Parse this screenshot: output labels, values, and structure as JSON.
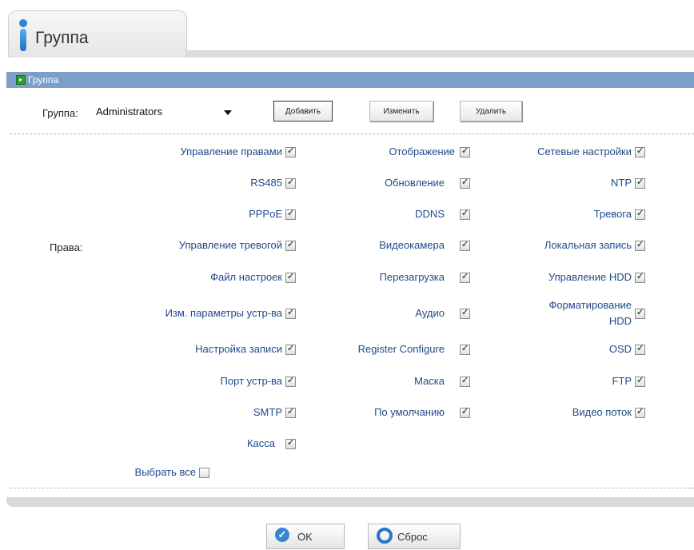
{
  "tab": {
    "title": "Группа"
  },
  "section": {
    "title": "Группа"
  },
  "group": {
    "label": "Группа:",
    "selected": "Administrators",
    "add_label": "Добавить",
    "edit_label": "Изменить",
    "delete_label": "Удалить"
  },
  "rights_label": "Права:",
  "permissions": {
    "col1": [
      {
        "label": "Управление правами",
        "checked": true
      },
      {
        "label": "RS485",
        "checked": true
      },
      {
        "label": "PPPoE",
        "checked": true
      },
      {
        "label": "Управление тревогой",
        "checked": true
      },
      {
        "label": "Файл настроек",
        "checked": true
      },
      {
        "label": "Изм. параметры устр-ва",
        "checked": true
      },
      {
        "label": "Настройка записи",
        "checked": true
      },
      {
        "label": "Порт устр-ва",
        "checked": true
      },
      {
        "label": "SMTP",
        "checked": true
      },
      {
        "label": "Касса",
        "checked": true
      }
    ],
    "col2": [
      {
        "label": "Отображение",
        "checked": true
      },
      {
        "label": "Обновление",
        "checked": true
      },
      {
        "label": "DDNS",
        "checked": true
      },
      {
        "label": "Видеокамера",
        "checked": true
      },
      {
        "label": "Перезагрузка",
        "checked": true
      },
      {
        "label": "Аудио",
        "checked": true
      },
      {
        "label": "Register Configure",
        "checked": true
      },
      {
        "label": "Маска",
        "checked": true
      },
      {
        "label": "По умолчанию",
        "checked": true
      }
    ],
    "col3": [
      {
        "label": "Сетевые настройки",
        "checked": true
      },
      {
        "label": "NTP",
        "checked": true
      },
      {
        "label": "Тревога",
        "checked": true
      },
      {
        "label": "Локальная запись",
        "checked": true
      },
      {
        "label": "Управление HDD",
        "checked": true
      },
      {
        "label": "Форматирование HDD",
        "line1": "Форматирование",
        "line2": "HDD",
        "checked": true
      },
      {
        "label": "OSD",
        "checked": true
      },
      {
        "label": "FTP",
        "checked": true
      },
      {
        "label": "Видео поток",
        "checked": true
      }
    ]
  },
  "select_all": {
    "label": "Выбрать все",
    "checked": false
  },
  "footer": {
    "ok_label": "OK",
    "reset_label": "Сброс"
  }
}
